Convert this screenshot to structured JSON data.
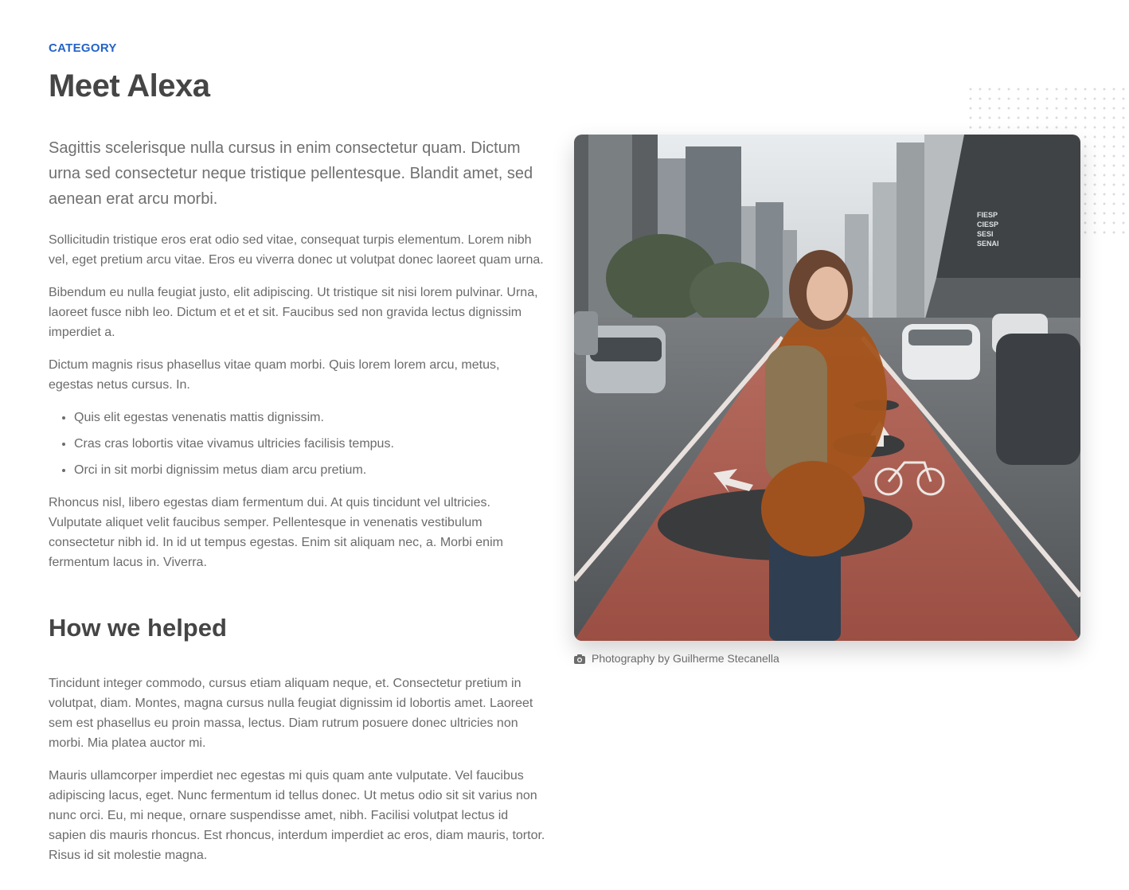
{
  "header": {
    "category": "CATEGORY",
    "title": "Meet Alexa"
  },
  "article": {
    "lead": "Sagittis scelerisque nulla cursus in enim consectetur quam. Dictum urna sed consectetur neque tristique pellentesque. Blandit amet, sed aenean erat arcu morbi.",
    "paragraphs": [
      "Sollicitudin tristique eros erat odio sed vitae, consequat turpis elementum. Lorem nibh vel, eget pretium arcu vitae. Eros eu viverra donec ut volutpat donec laoreet quam urna.",
      "Bibendum eu nulla feugiat justo, elit adipiscing. Ut tristique sit nisi lorem pulvinar. Urna, laoreet fusce nibh leo. Dictum et et et sit. Faucibus sed non gravida lectus dignissim imperdiet a.",
      "Dictum magnis risus phasellus vitae quam morbi. Quis lorem lorem arcu, metus, egestas netus cursus. In."
    ],
    "bullets": [
      "Quis elit egestas venenatis mattis dignissim.",
      "Cras cras lobortis vitae vivamus ultricies facilisis tempus.",
      "Orci in sit morbi dignissim metus diam arcu pretium."
    ],
    "after_list": "Rhoncus nisl, libero egestas diam fermentum dui. At quis tincidunt vel ultricies. Vulputate aliquet velit faucibus semper. Pellentesque in venenatis vestibulum consectetur nibh id. In id ut tempus egestas. Enim sit aliquam nec, a. Morbi enim fermentum lacus in. Viverra.",
    "section_heading": "How we helped",
    "section_paragraphs": [
      "Tincidunt integer commodo, cursus etiam aliquam neque, et. Consectetur pretium in volutpat, diam. Montes, magna cursus nulla feugiat dignissim id lobortis amet. Laoreet sem est phasellus eu proin massa, lectus. Diam rutrum posuere donec ultricies non morbi. Mia platea auctor mi.",
      "Mauris ullamcorper imperdiet nec egestas mi quis quam ante vulputate. Vel faucibus adipiscing lacus, eget. Nunc fermentum id tellus donec. Ut metus odio sit sit varius non nunc orci. Eu, mi neque, ornare suspendisse amet, nibh. Facilisi volutpat lectus id sapien dis mauris rhoncus. Est rhoncus, interdum imperdiet ac eros, diam mauris, tortor. Risus id sit molestie magna."
    ]
  },
  "figure": {
    "caption": "Photography by Guilherme Stecanella",
    "caption_icon": "camera-icon",
    "building_sign": [
      "FIESP",
      "CIESP",
      "SESI",
      "SENAI"
    ]
  },
  "colors": {
    "accent": "#2563c7",
    "heading": "#454545",
    "body_text": "#6b6b6b"
  }
}
